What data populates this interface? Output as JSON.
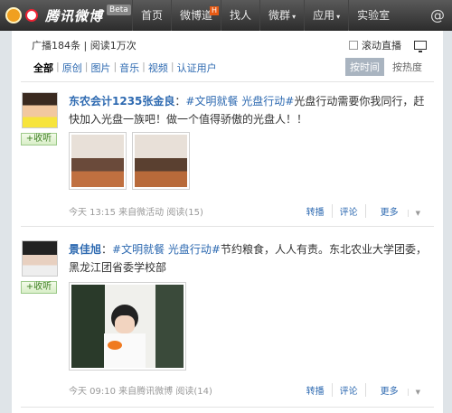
{
  "brand": {
    "logo_text": "腾讯微博",
    "beta": "Beta"
  },
  "nav": {
    "items": [
      {
        "label": "首页"
      },
      {
        "label": "微博道",
        "badge": "H"
      },
      {
        "label": "找人"
      },
      {
        "label": "微群",
        "arrow": "▾"
      },
      {
        "label": "应用",
        "arrow": "▾"
      },
      {
        "label": "实验室"
      }
    ],
    "at": "@"
  },
  "stats": {
    "broadcast": "广播184条",
    "sep": "|",
    "reads": "阅读1万次"
  },
  "live": {
    "label": "滚动直播"
  },
  "filters": [
    "全部",
    "原创",
    "图片",
    "音乐",
    "视频",
    "认证用户"
  ],
  "sorts": {
    "by_time": "按时间",
    "by_hot": "按热度"
  },
  "follow_label": "+收听",
  "posts": [
    {
      "author": "东农会计1235张金良",
      "colon": "：",
      "tag": "#文明就餐 光盘行动#",
      "text": "光盘行动需要你我同行，赶快加入光盘一族吧！做一个值得骄傲的光盘人！！",
      "meta": "今天 13:15 来自微活动 阅读(15)",
      "actions": {
        "forward": "转播",
        "comment": "评论",
        "more": "更多"
      }
    },
    {
      "author": "景佳旭",
      "colon": "：",
      "tag": "#文明就餐 光盘行动#",
      "text": "节约粮食，人人有责。东北农业大学团委，黑龙江团省委学校部",
      "meta": "今天 09:10 来自腾讯微博 阅读(14)",
      "actions": {
        "forward": "转播",
        "comment": "评论",
        "more": "更多"
      }
    }
  ],
  "colors": {
    "link": "#2e6ab1",
    "topbar": "#3a3a3a",
    "follow_green": "#3b7d1f"
  }
}
